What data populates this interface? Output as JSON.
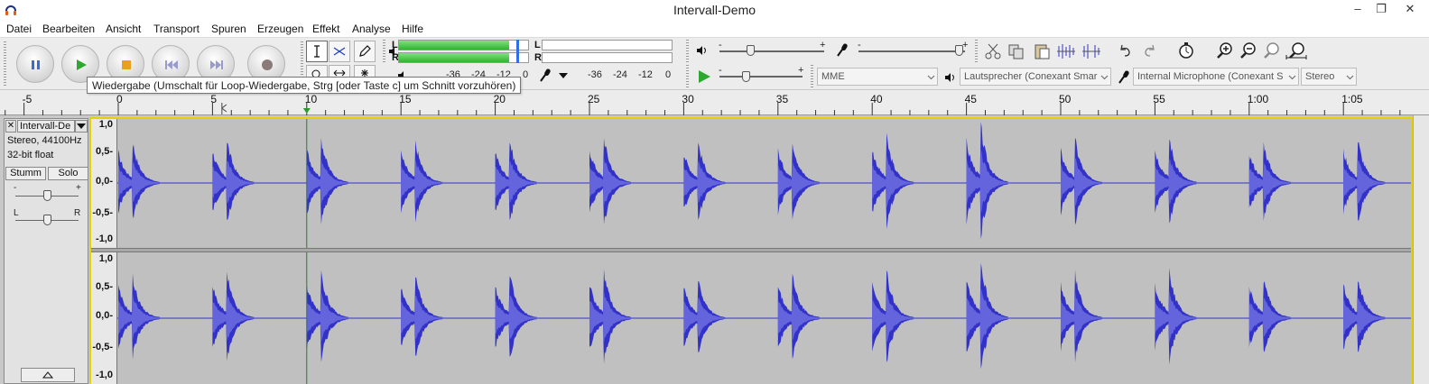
{
  "window": {
    "title": "Intervall-Demo",
    "minimize": "–",
    "maximize": "❐",
    "close": "✕"
  },
  "menu": [
    "Datei",
    "Bearbeiten",
    "Ansicht",
    "Transport",
    "Spuren",
    "Erzeugen",
    "Effekt",
    "Analyse",
    "Hilfe"
  ],
  "meter": {
    "play_left": "L",
    "play_right": "R",
    "rec_left": "L",
    "rec_right": "R",
    "play_scale": [
      "-36",
      "-24",
      "-12",
      "0"
    ],
    "rec_scale": [
      "-36",
      "-24",
      "-12",
      "0"
    ],
    "play_level_fraction": 0.85
  },
  "mixer": {
    "out_minus": "-",
    "out_plus": "+",
    "in_minus": "-",
    "in_plus": "+",
    "speed_minus": "-",
    "speed_plus": "+"
  },
  "devices": {
    "host": "MME",
    "output": "Lautsprecher (Conexant Smar",
    "input": "Internal Microphone (Conexant S",
    "channels": "Stereo"
  },
  "tooltip": "Wiedergabe (Umschalt für Loop-Wiedergabe, Strg [oder Taste c] um Schnitt vorzuhören)",
  "ruler": {
    "labels": [
      "-5",
      "0",
      "5",
      "10",
      "15",
      "20",
      "25",
      "30",
      "35",
      "40",
      "45",
      "50",
      "55",
      "1:00",
      "1:05"
    ]
  },
  "track": {
    "name": "Intervall-De",
    "close": "✕",
    "format": "Stereo, 44100Hz",
    "bitdepth": "32-bit float",
    "mute": "Stumm",
    "solo": "Solo",
    "gain_minus": "-",
    "gain_plus": "+",
    "pan_left": "L",
    "pan_right": "R",
    "scale": [
      "1,0",
      "0,5-",
      "0,0-",
      "-0,5-",
      "-1,0"
    ],
    "note_onsets_seconds": [
      0,
      5,
      10,
      15,
      20,
      25,
      30,
      35,
      40,
      45,
      50,
      55,
      60,
      65
    ],
    "cursor_seconds": 10
  },
  "colors": {
    "waveform": "#3232c8",
    "waveform_rms": "#6464dc",
    "track_bg": "#c0c0c0",
    "meter_green": "#3cc83c",
    "play_green": "#2ea82e",
    "stop_orange": "#e8a020",
    "pause_blue": "#3a6ad8",
    "record_red": "#b02020",
    "focus_yellow": "#e4d100"
  }
}
